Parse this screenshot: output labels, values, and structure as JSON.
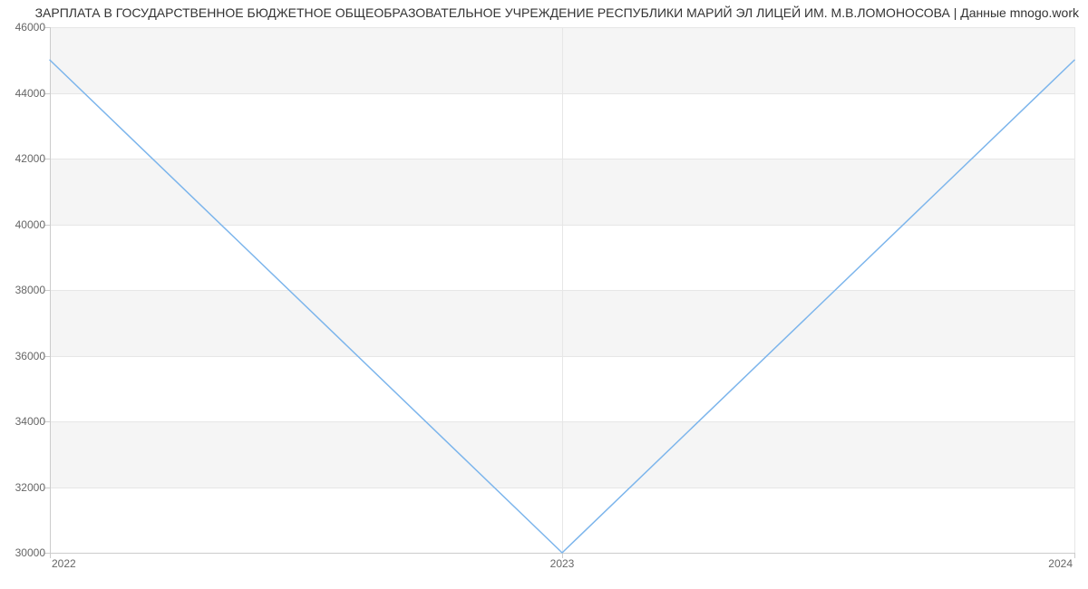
{
  "chart_data": {
    "type": "line",
    "title": "ЗАРПЛАТА В ГОСУДАРСТВЕННОЕ БЮДЖЕТНОЕ ОБЩЕОБРАЗОВАТЕЛЬНОЕ УЧРЕЖДЕНИЕ РЕСПУБЛИКИ МАРИЙ ЭЛ ЛИЦЕЙ ИМ. М.В.ЛОМОНОСОВА | Данные mnogo.work",
    "x": [
      2022,
      2023,
      2024
    ],
    "values": [
      45000,
      30000,
      45000
    ],
    "xlabel": "",
    "ylabel": "",
    "y_ticks": [
      30000,
      32000,
      34000,
      36000,
      38000,
      40000,
      42000,
      44000,
      46000
    ],
    "y_tick_labels": [
      "30000",
      "32000",
      "34000",
      "36000",
      "38000",
      "40000",
      "42000",
      "44000",
      "46000"
    ],
    "x_tick_labels": [
      "2022",
      "2023",
      "2024"
    ],
    "ylim": [
      30000,
      46000
    ],
    "xlim": [
      2022,
      2024
    ],
    "line_color": "#7cb5ec",
    "grid": true
  }
}
